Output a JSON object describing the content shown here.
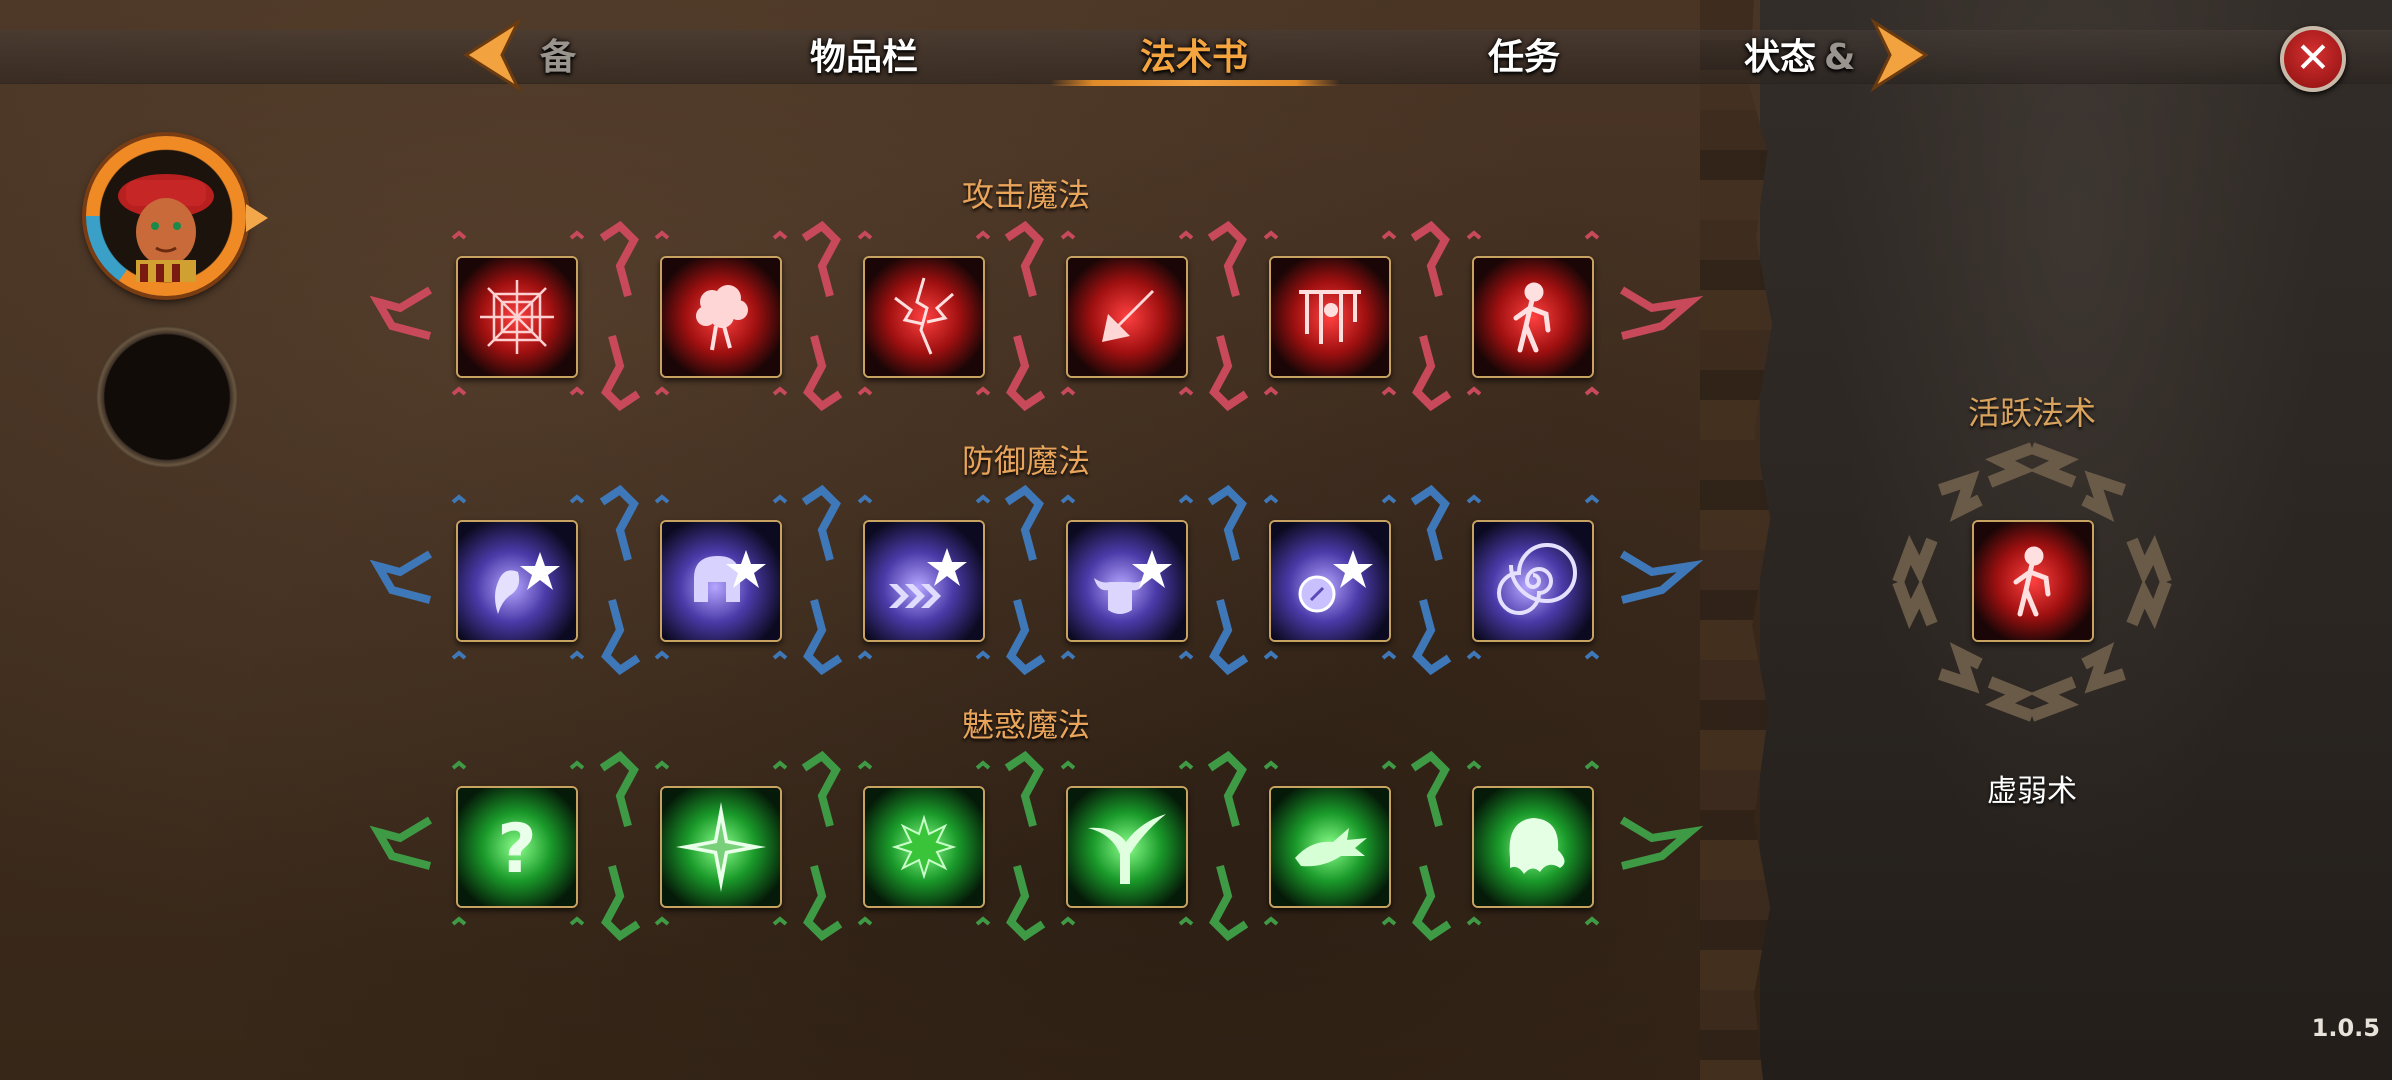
{
  "tabs": {
    "prev_partial": "备",
    "inventory": "物品栏",
    "spellbook": "法术书",
    "quests": "任务",
    "status": "状态",
    "next_partial": "&"
  },
  "sections": {
    "attack": {
      "title": "攻击魔法",
      "color": "#c84a5a",
      "icons": [
        "web-spell-icon",
        "brain-burst-spell-icon",
        "lightning-spell-icon",
        "arrow-down-spell-icon",
        "rain-figure-spell-icon",
        "weakness-spell-icon"
      ]
    },
    "defense": {
      "title": "防御魔法",
      "color": "#3f78b8",
      "icons": [
        "ghost-star-spell-icon",
        "helmet-star-spell-icon",
        "speed-star-spell-icon",
        "bull-star-spell-icon",
        "orb-star-spell-icon",
        "spiral-spell-icon"
      ]
    },
    "charm": {
      "title": "魅惑魔法",
      "color": "#3f9a46",
      "icons": [
        "question-spell-icon",
        "compass-star-spell-icon",
        "spiky-burst-spell-icon",
        "claw-spell-icon",
        "dragon-spell-icon",
        "ghost-spell-icon"
      ]
    }
  },
  "active_spell": {
    "title": "活跃法术",
    "name": "虚弱术",
    "icon": "weakness-spell-icon"
  },
  "version": "1.0.5",
  "colors": {
    "accent": "#f5a540",
    "attack": "#d8282e",
    "defense": "#7a6cff",
    "charm": "#28d040"
  }
}
